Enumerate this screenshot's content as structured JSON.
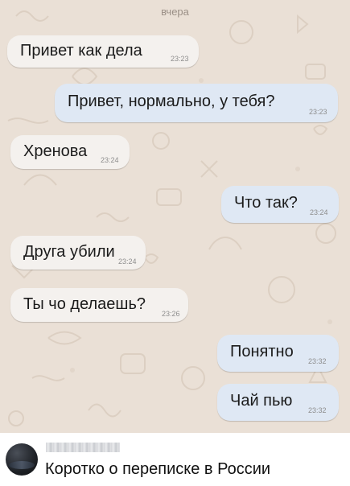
{
  "chat": {
    "date_label": "вчера",
    "background_color": "#eae0d6",
    "messages": [
      {
        "direction": "in",
        "text": "Привет как дела",
        "time": "23:23"
      },
      {
        "direction": "out",
        "text": "Привет, нормально, у тебя?",
        "time": "23:23"
      },
      {
        "direction": "in",
        "text": "Хренова",
        "time": "23:24"
      },
      {
        "direction": "out",
        "text": "Что так?",
        "time": "23:24"
      },
      {
        "direction": "in",
        "text": "Друга убили",
        "time": "23:24"
      },
      {
        "direction": "in",
        "text": "Ты чо делаешь?",
        "time": "23:26"
      },
      {
        "direction": "out",
        "text": "Понятно",
        "time": "23:32"
      },
      {
        "direction": "out",
        "text": "Чай пью",
        "time": "23:32"
      }
    ],
    "incoming_bubble_color": "#f4f1ee",
    "outgoing_bubble_color": "#dfe8f4"
  },
  "post": {
    "caption": "Коротко о переписке в России",
    "avatar_icon": "avatar-photo",
    "username_blurred": true
  }
}
